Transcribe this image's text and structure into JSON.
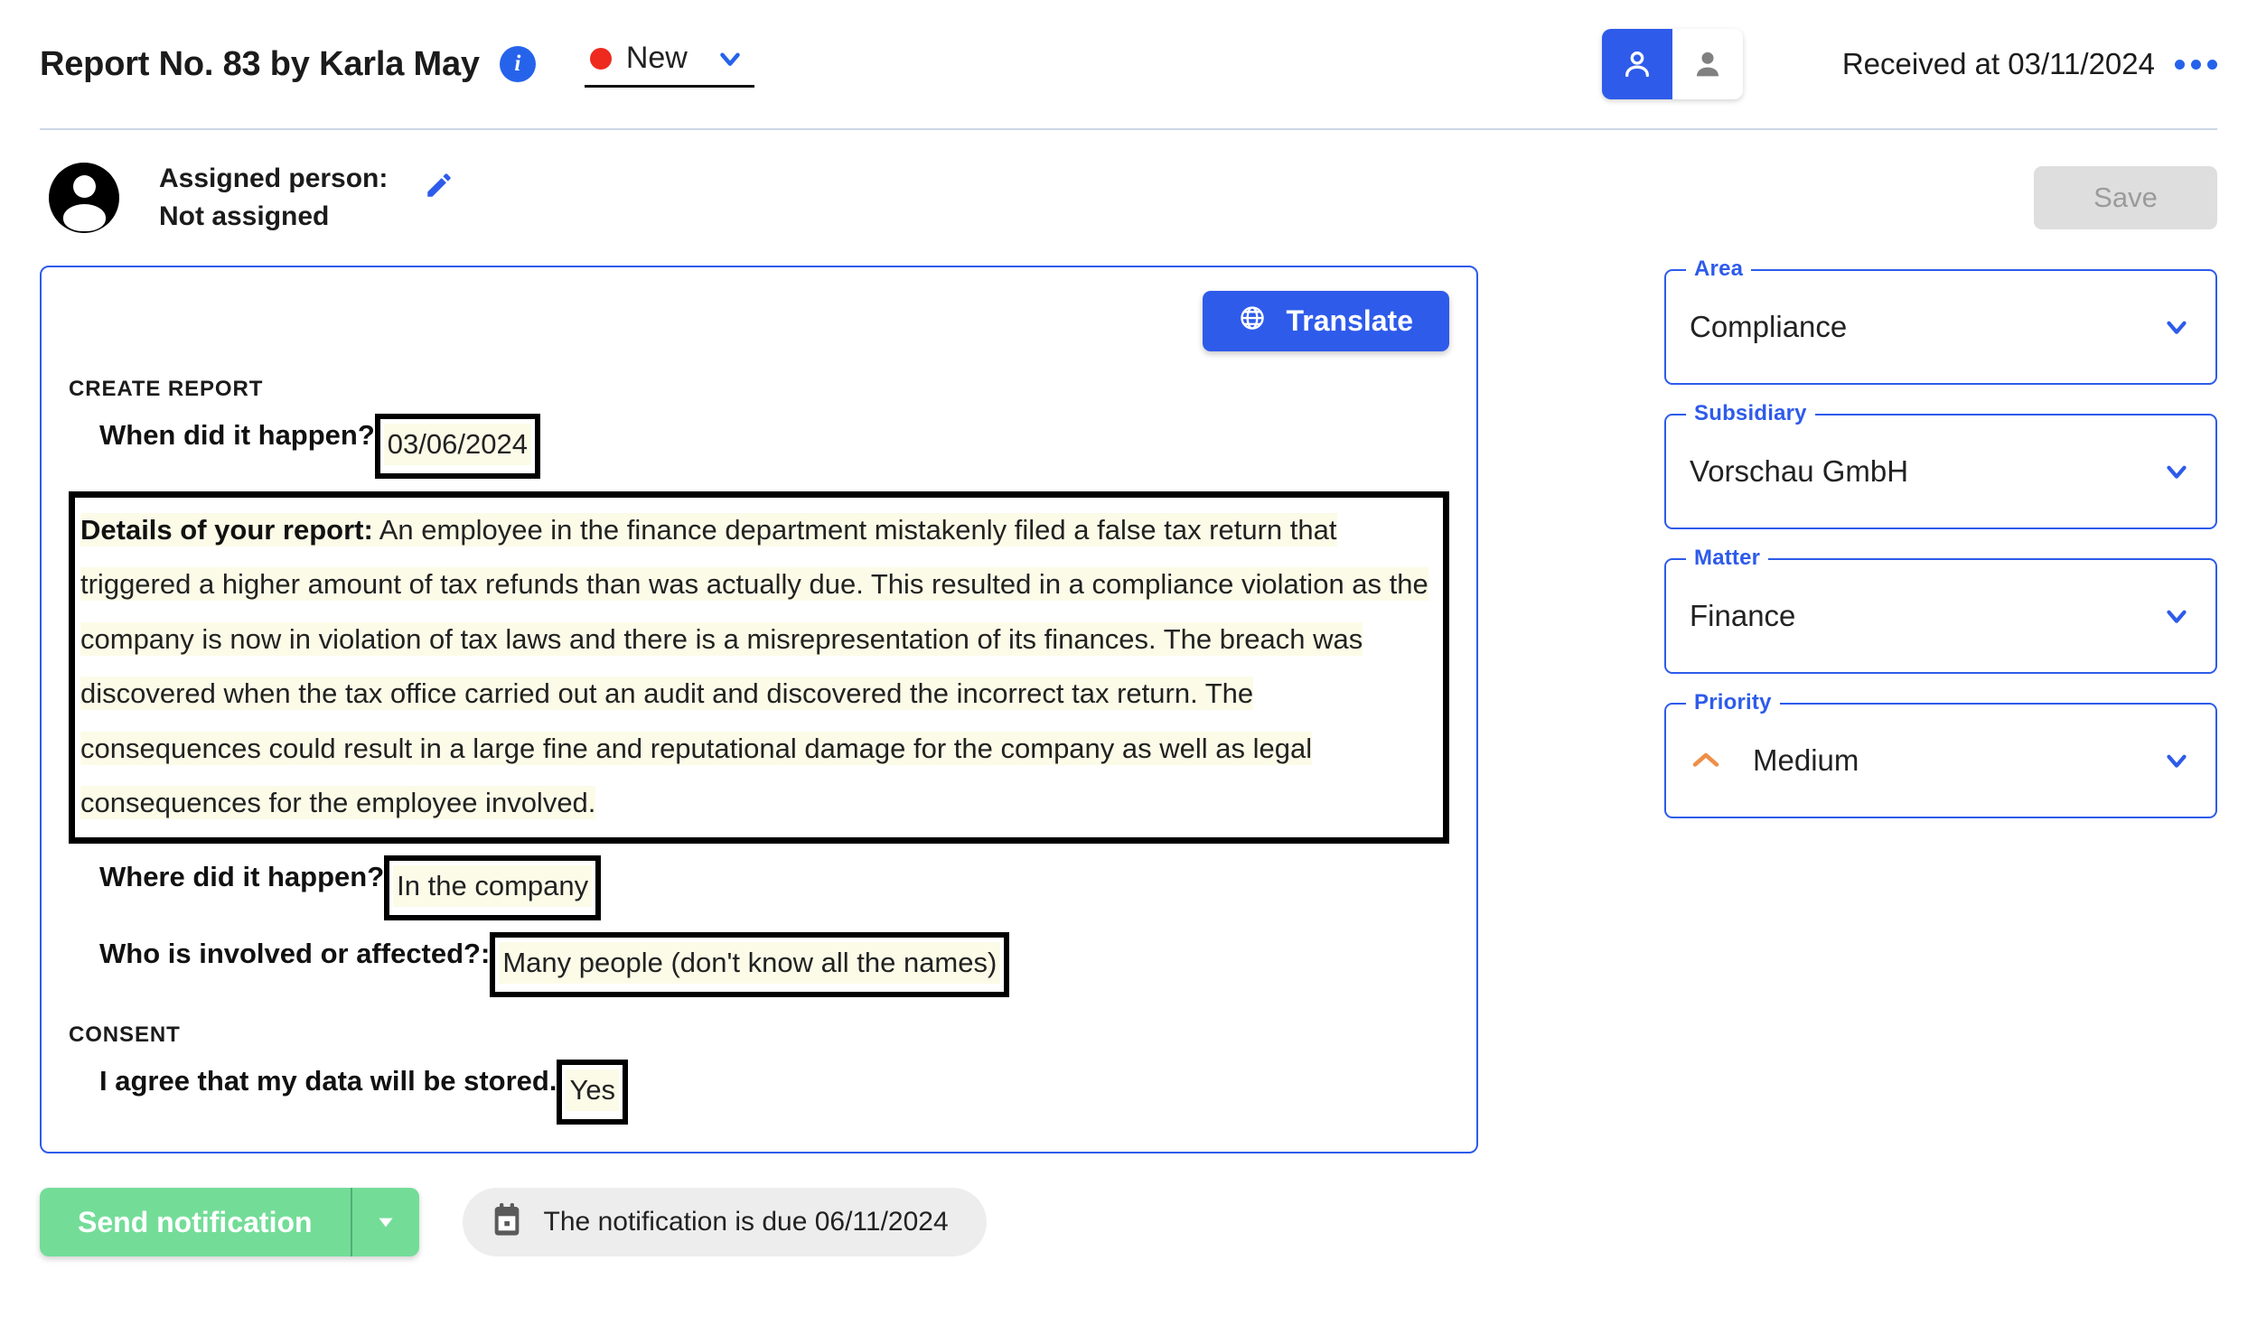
{
  "header": {
    "title": "Report No. 83 by Karla May",
    "info_icon": "info-icon",
    "status": {
      "label": "New",
      "dot_color": "#ee2a1e",
      "chevron": "chevron-down-icon"
    },
    "person_toggle": {
      "active_icon": "person-outline-icon",
      "inactive_icon": "person-filled-icon",
      "active_color": "#2e5bea"
    },
    "received_text": "Received at 03/11/2024",
    "overflow_menu": "more-options-icon"
  },
  "assigned": {
    "avatar": "user-avatar-icon",
    "label_line1": "Assigned person:",
    "label_line2": "Not assigned",
    "edit_icon": "pencil-icon",
    "save_label": "Save"
  },
  "report": {
    "translate_label": "Translate",
    "translate_icon": "globe-icon",
    "section_create": "CREATE REPORT",
    "q_when": "When did it happen?",
    "a_when": "03/06/2024",
    "details_label": "Details of your report:",
    "details_text": "An employee in the finance department mistakenly filed a false tax return that triggered a higher amount of tax refunds than was actually due. This resulted in a compliance violation as the company is now in violation of tax laws and there is a misrepresentation of its finances. The breach was discovered when the tax office carried out an audit and discovered the incorrect tax return. The consequences could result in a large fine and reputational damage for the company as well as legal consequences for the employee involved.",
    "q_where": "Where did it happen?",
    "a_where": "In the company",
    "q_who": "Who is involved or affected?:",
    "a_who": "Many people (don't know all the names)",
    "section_consent": "CONSENT",
    "q_consent": "I agree that my data will be stored.",
    "a_consent": "Yes"
  },
  "side_panel": {
    "fields": [
      {
        "legend": "Area",
        "value": "Compliance",
        "icon": ""
      },
      {
        "legend": "Subsidiary",
        "value": "Vorschau GmbH",
        "icon": ""
      },
      {
        "legend": "Matter",
        "value": "Finance",
        "icon": ""
      },
      {
        "legend": "Priority",
        "value": "Medium",
        "icon": "priority-medium-icon"
      }
    ]
  },
  "footer": {
    "send_label": "Send notification",
    "send_caret": "caret-down-icon",
    "due_icon": "calendar-icon",
    "due_text": "The notification is due 06/11/2024"
  },
  "colors": {
    "accent_blue": "#2e5bea",
    "status_red": "#ee2a1e",
    "green": "#73dd98",
    "highlight": "#fbfbe8",
    "priority_orange": "#ef8f48"
  }
}
